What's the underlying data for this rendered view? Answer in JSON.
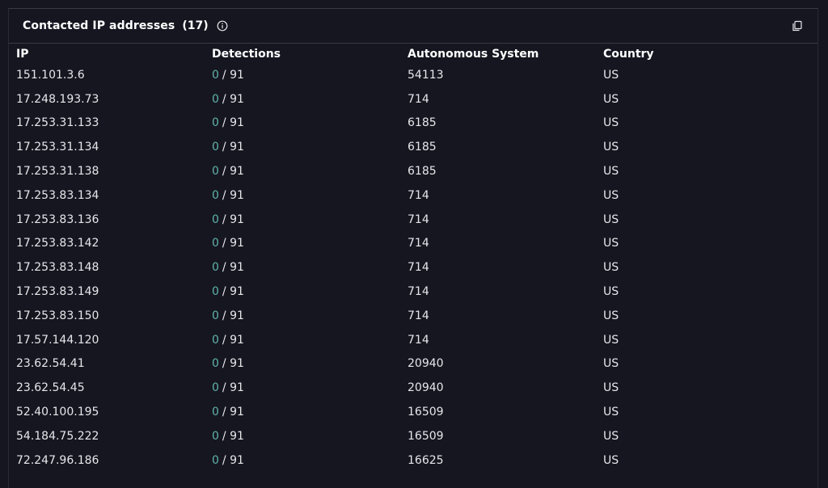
{
  "header": {
    "title": "Contacted IP addresses",
    "count": "(17)"
  },
  "table": {
    "columns": [
      "IP",
      "Detections",
      "Autonomous System",
      "Country"
    ],
    "rows": [
      {
        "ip": "151.101.3.6",
        "detections": "0",
        "total": "/ 91",
        "asn": "54113",
        "country": "US"
      },
      {
        "ip": "17.248.193.73",
        "detections": "0",
        "total": "/ 91",
        "asn": "714",
        "country": "US"
      },
      {
        "ip": "17.253.31.133",
        "detections": "0",
        "total": "/ 91",
        "asn": "6185",
        "country": "US"
      },
      {
        "ip": "17.253.31.134",
        "detections": "0",
        "total": "/ 91",
        "asn": "6185",
        "country": "US"
      },
      {
        "ip": "17.253.31.138",
        "detections": "0",
        "total": "/ 91",
        "asn": "6185",
        "country": "US"
      },
      {
        "ip": "17.253.83.134",
        "detections": "0",
        "total": "/ 91",
        "asn": "714",
        "country": "US"
      },
      {
        "ip": "17.253.83.136",
        "detections": "0",
        "total": "/ 91",
        "asn": "714",
        "country": "US"
      },
      {
        "ip": "17.253.83.142",
        "detections": "0",
        "total": "/ 91",
        "asn": "714",
        "country": "US"
      },
      {
        "ip": "17.253.83.148",
        "detections": "0",
        "total": "/ 91",
        "asn": "714",
        "country": "US"
      },
      {
        "ip": "17.253.83.149",
        "detections": "0",
        "total": "/ 91",
        "asn": "714",
        "country": "US"
      },
      {
        "ip": "17.253.83.150",
        "detections": "0",
        "total": "/ 91",
        "asn": "714",
        "country": "US"
      },
      {
        "ip": "17.57.144.120",
        "detections": "0",
        "total": "/ 91",
        "asn": "714",
        "country": "US"
      },
      {
        "ip": "23.62.54.41",
        "detections": "0",
        "total": "/ 91",
        "asn": "20940",
        "country": "US"
      },
      {
        "ip": "23.62.54.45",
        "detections": "0",
        "total": "/ 91",
        "asn": "20940",
        "country": "US"
      },
      {
        "ip": "52.40.100.195",
        "detections": "0",
        "total": "/ 91",
        "asn": "16509",
        "country": "US"
      },
      {
        "ip": "54.184.75.222",
        "detections": "0",
        "total": "/ 91",
        "asn": "16509",
        "country": "US"
      },
      {
        "ip": "72.247.96.186",
        "detections": "0",
        "total": "/ 91",
        "asn": "16625",
        "country": "US"
      }
    ]
  },
  "icons": {
    "info": "info-icon",
    "copy": "copy-icon"
  },
  "colors": {
    "background": "#161621",
    "detection_zero": "#5fb3a8",
    "divider": "#3a3a46"
  }
}
